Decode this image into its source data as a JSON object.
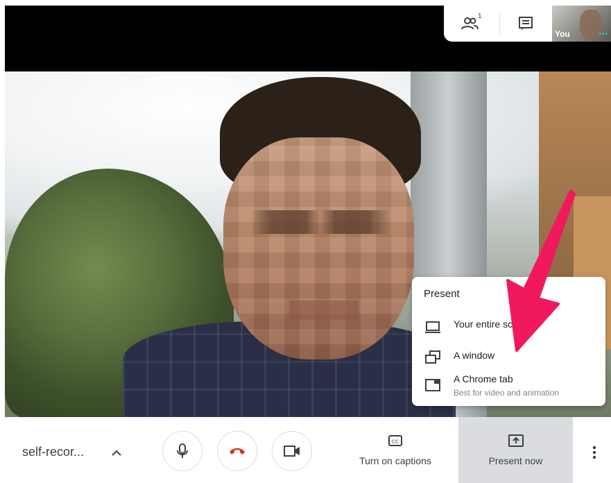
{
  "top_panel": {
    "participants_icon": "people-icon",
    "participants_count": "1",
    "chat_icon": "chat-icon",
    "self_label": "You"
  },
  "present_menu": {
    "title": "Present",
    "items": [
      {
        "icon": "monitor-icon",
        "label": "Your entire screen"
      },
      {
        "icon": "window-icon",
        "label": "A window"
      },
      {
        "icon": "chrome-tab-icon",
        "label": "A Chrome tab",
        "sublabel": "Best for video and animation"
      }
    ]
  },
  "bottom_bar": {
    "meeting_title": "self-recor...",
    "captions_label": "Turn on captions",
    "present_label": "Present now"
  },
  "colors": {
    "arrow": "#f0195e",
    "end_call": "#d93025",
    "present_bg": "#dadce0"
  }
}
